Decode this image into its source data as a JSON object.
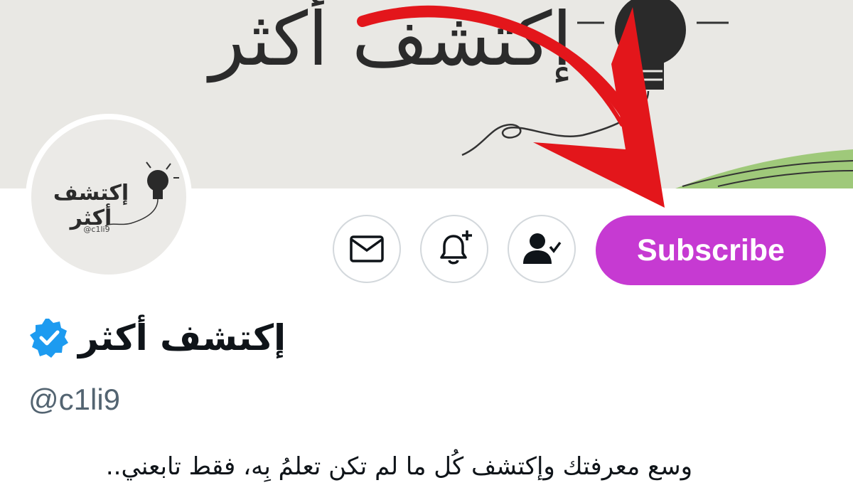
{
  "banner": {
    "title": "إكتشف أكثر"
  },
  "avatar": {
    "title": "إكتشف أكثر",
    "handle": "@c1li9"
  },
  "actions": {
    "message_icon": "envelope-icon",
    "notify_icon": "bell-plus-icon",
    "following_icon": "person-check-icon",
    "subscribe_label": "Subscribe"
  },
  "profile": {
    "display_name": "إكتشف أكثر",
    "verified_icon": "verified-badge-icon",
    "handle": "@c1li9",
    "bio": "وسع معرفتك وإكتشف كُل ما لم تكن تعلمُ بِه، فقط تابعني.."
  },
  "colors": {
    "subscribe": "#c63ad2",
    "verified": "#1d9bf0",
    "arrow": "#e3161b",
    "handle": "#536471"
  }
}
